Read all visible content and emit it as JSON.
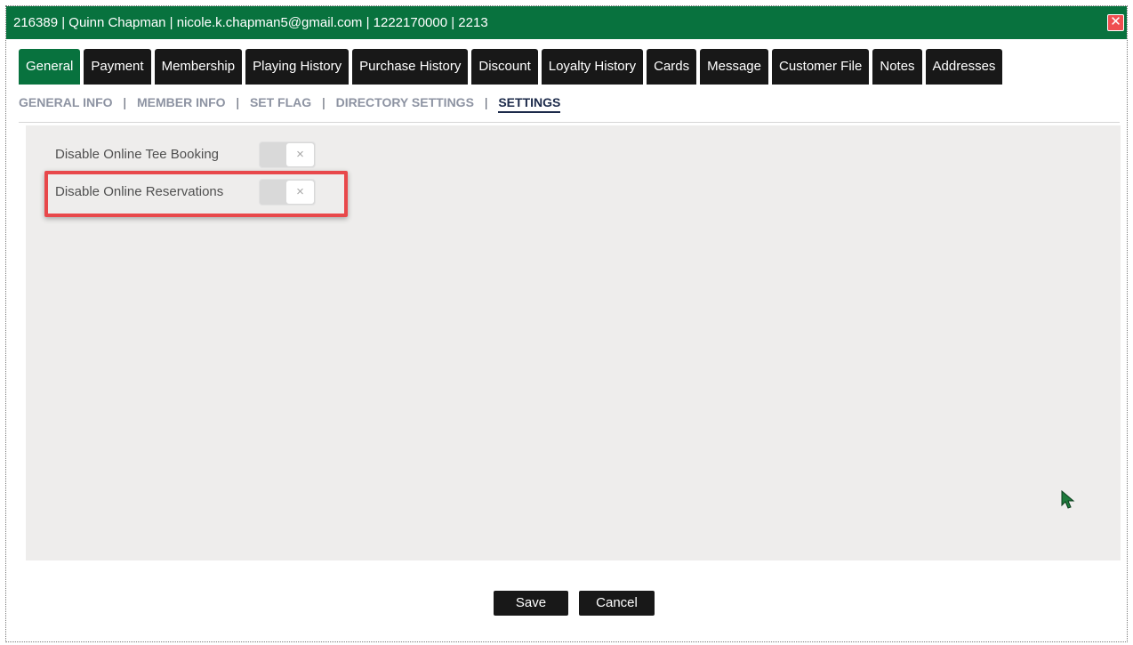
{
  "window": {
    "title": "216389 | Quinn Chapman | nicole.k.chapman5@gmail.com | 1222170000 | 2213",
    "close_icon": "✕"
  },
  "tabs": [
    {
      "label": "General",
      "active": true
    },
    {
      "label": "Payment",
      "active": false
    },
    {
      "label": "Membership",
      "active": false
    },
    {
      "label": "Playing History",
      "active": false
    },
    {
      "label": "Purchase History",
      "active": false
    },
    {
      "label": "Discount",
      "active": false
    },
    {
      "label": "Loyalty History",
      "active": false
    },
    {
      "label": "Cards",
      "active": false
    },
    {
      "label": "Message",
      "active": false
    },
    {
      "label": "Customer File",
      "active": false
    },
    {
      "label": "Notes",
      "active": false
    },
    {
      "label": "Addresses",
      "active": false
    }
  ],
  "subnav": {
    "items": [
      "GENERAL INFO",
      "MEMBER INFO",
      "SET FLAG",
      "DIRECTORY SETTINGS",
      "SETTINGS"
    ],
    "separator": "|",
    "active": "SETTINGS"
  },
  "settings": [
    {
      "label": "Disable Online Tee Booking",
      "enabled": false,
      "toggle_glyph": "×"
    },
    {
      "label": "Disable Online Reservations",
      "enabled": false,
      "toggle_glyph": "×"
    }
  ],
  "footer": {
    "save_label": "Save",
    "cancel_label": "Cancel"
  },
  "colors": {
    "accent_green": "#08723e",
    "tab_dark": "#181818",
    "highlight_red": "#e8484b",
    "cursor_green": "#1e7a3c"
  },
  "icons": {
    "close": "close-icon",
    "toggle": "x-icon",
    "cursor": "mouse-pointer-icon"
  }
}
